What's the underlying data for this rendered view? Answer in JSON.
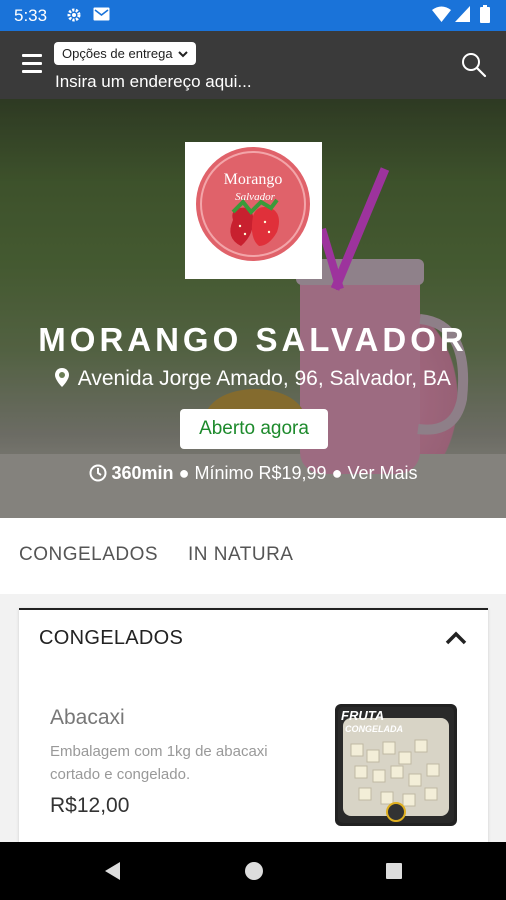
{
  "status_bar": {
    "time": "5:33",
    "icons": [
      "gear-icon",
      "mail-icon",
      "wifi-icon",
      "signal-icon",
      "battery-icon"
    ]
  },
  "app_bar": {
    "delivery_options_label": "Opções de entrega",
    "address_placeholder": "Insira um endereço aqui...",
    "icons": [
      "menu-icon",
      "chevron-down-icon",
      "search-icon"
    ]
  },
  "store": {
    "logo_text_line1": "Morango",
    "logo_text_line2": "Salvador",
    "name": "MORANGO SALVADOR",
    "address": "Avenida Jorge Amado, 96, Salvador, BA",
    "status": "Aberto agora",
    "delivery_time": "360min",
    "minimum": "Mínimo R$19,99",
    "more": "Ver Mais",
    "separator": "●"
  },
  "tabs": [
    {
      "label": "CONGELADOS"
    },
    {
      "label": "IN NATURA"
    }
  ],
  "category": {
    "title": "CONGELADOS",
    "products": [
      {
        "name": "Abacaxi",
        "description": "Embalagem com 1kg de abacaxi cortado e congelado.",
        "price": "R$12,00",
        "image_label_line1": "FRUTA",
        "image_label_line2": "CONGELADA"
      }
    ]
  },
  "colors": {
    "status_bar": "#1a73d9",
    "app_bar": "#3a3a3a",
    "open_badge_text": "#1d8a2c",
    "logo_circle": "#e0626a"
  }
}
